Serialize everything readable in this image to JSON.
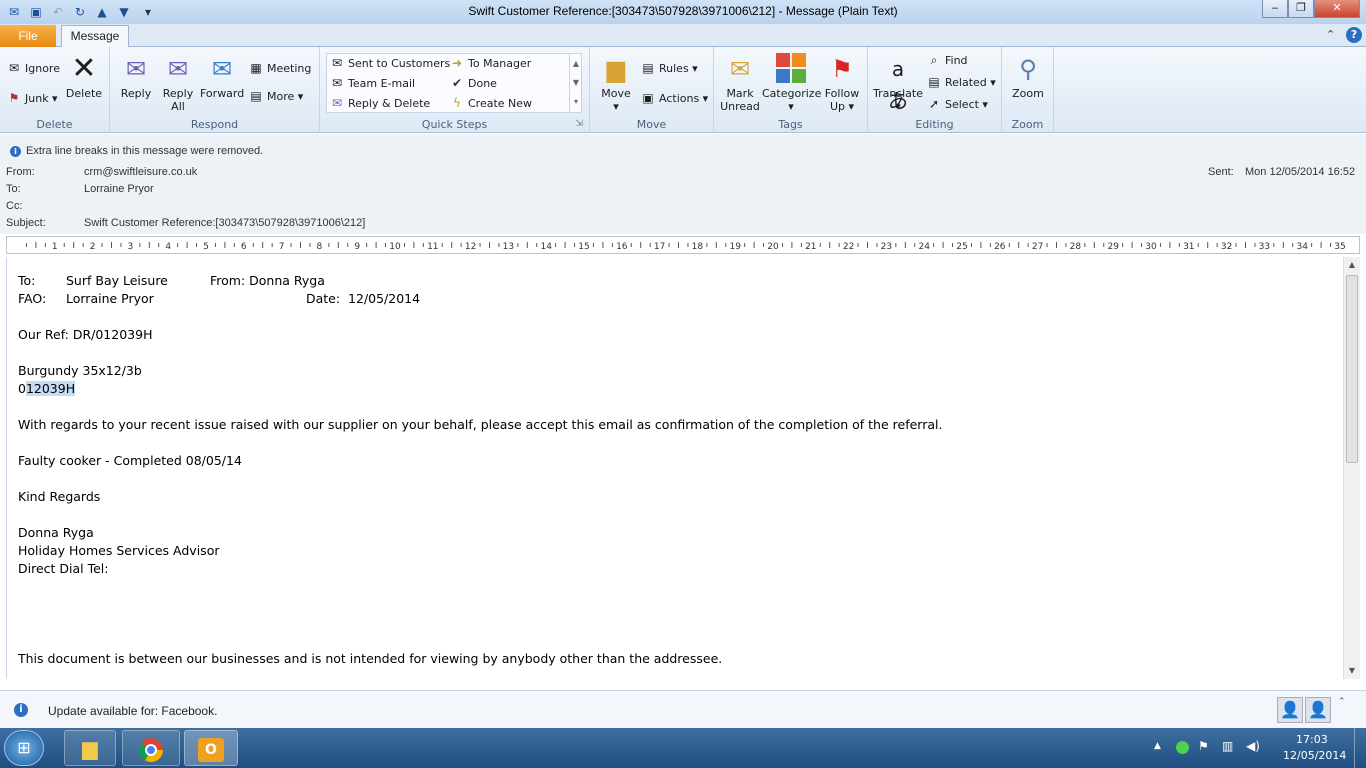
{
  "window": {
    "title": "Swift Customer Reference:[303473\\507928\\3971006\\212]  -  Message (Plain Text)"
  },
  "tabs": {
    "file": "File",
    "message": "Message"
  },
  "ribbon": {
    "delete_group": {
      "ignore": "Ignore",
      "junk": "Junk",
      "delete": "Delete",
      "label": "Delete"
    },
    "respond_group": {
      "reply": "Reply",
      "reply_all_1": "Reply",
      "reply_all_2": "All",
      "forward": "Forward",
      "meeting": "Meeting",
      "more": "More",
      "label": "Respond"
    },
    "quick_steps": {
      "sent_to_customers": "Sent to Customers",
      "to_manager": "To Manager",
      "team_email": "Team E-mail",
      "done": "Done",
      "reply_delete": "Reply & Delete",
      "create_new": "Create New",
      "label": "Quick Steps"
    },
    "move_group": {
      "move": "Move",
      "rules": "Rules",
      "actions": "Actions",
      "label": "Move"
    },
    "tags_group": {
      "mark_unread_1": "Mark",
      "mark_unread_2": "Unread",
      "categorize": "Categorize",
      "follow_up_1": "Follow",
      "follow_up_2": "Up",
      "label": "Tags"
    },
    "editing_group": {
      "translate": "Translate",
      "find": "Find",
      "related": "Related",
      "select": "Select",
      "label": "Editing"
    },
    "zoom_group": {
      "zoom": "Zoom",
      "label": "Zoom"
    }
  },
  "infobar": {
    "text": "Extra line breaks in this message were removed."
  },
  "header": {
    "from_label": "From:",
    "from_value": "crm@swiftleisure.co.uk",
    "to_label": "To:",
    "to_value": "Lorraine Pryor",
    "cc_label": "Cc:",
    "cc_value": "",
    "subject_label": "Subject:",
    "subject_value": "Swift Customer Reference:[303473\\507928\\3971006\\212]",
    "sent_label": "Sent:",
    "sent_value": "Mon 12/05/2014 16:52"
  },
  "ruler": {
    "ticks": [
      "1",
      "2",
      "3",
      "4",
      "5",
      "6",
      "7",
      "8",
      "9",
      "10",
      "11",
      "12",
      "13",
      "14",
      "15",
      "16",
      "17",
      "18",
      "19",
      "20",
      "21",
      "22",
      "23",
      "24",
      "25",
      "26",
      "27",
      "28",
      "29",
      "30",
      "31",
      "32",
      "33",
      "34",
      "35"
    ]
  },
  "body": {
    "to_label": "To:",
    "to_value": "Surf Bay Leisure",
    "from_text": "From: Donna Ryga",
    "fao_label": "FAO:",
    "fao_value": "Lorraine Pryor",
    "date_text": "Date:  12/05/2014",
    "our_ref": "Our Ref: DR/012039H",
    "model": "Burgundy 35x12/3b",
    "ref_prefix": "0",
    "ref_selected": "12039H",
    "para1": "With regards to your recent issue raised with our supplier on your behalf, please accept this email as confirmation of the completion of the referral.",
    "faulty": "Faulty cooker - Completed 08/05/14",
    "regards": "Kind Regards",
    "name": "Donna Ryga",
    "role": "Holiday Homes Services Advisor",
    "dial": "Direct Dial Tel:",
    "disclaimer": "This document is between our businesses and is not intended for viewing by anybody other than the addressee."
  },
  "statusbar": {
    "text": "Update available for: Facebook."
  },
  "taskbar": {
    "time": "17:03",
    "date": "12/05/2014"
  }
}
